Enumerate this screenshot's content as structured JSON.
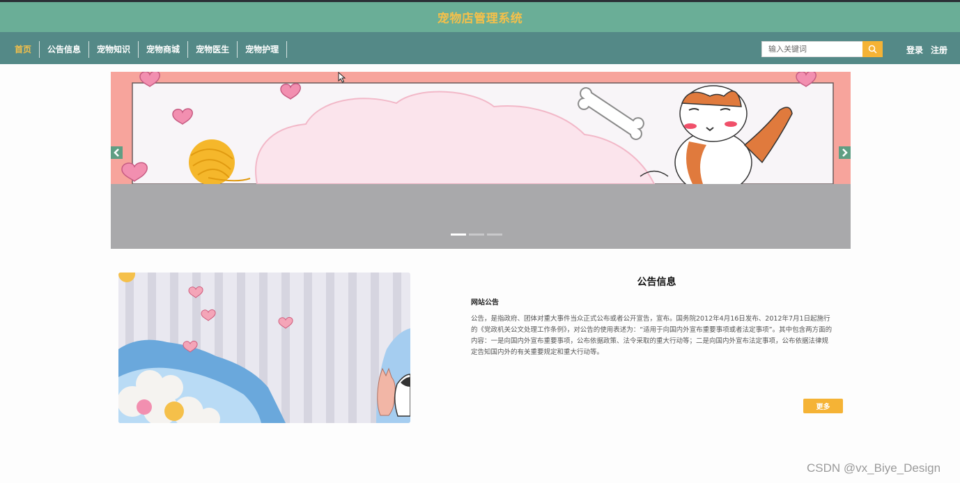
{
  "header": {
    "title": "宠物店管理系统"
  },
  "nav": {
    "items": [
      {
        "label": "首页"
      },
      {
        "label": "公告信息"
      },
      {
        "label": "宠物知识"
      },
      {
        "label": "宠物商城"
      },
      {
        "label": "宠物医生"
      },
      {
        "label": "宠物护理"
      }
    ]
  },
  "search": {
    "placeholder": "输入关键词",
    "value": ""
  },
  "auth": {
    "login": "登录",
    "register": "注册"
  },
  "carousel": {
    "slide_count": 3,
    "active_slide": 1
  },
  "notice": {
    "title": "公告信息",
    "subtitle": "网站公告",
    "body": "公告，是指政府、团体对重大事件当众正式公布或者公开宣告，宣布。国务院2012年4月16日发布、2012年7月1日起施行的《党政机关公文处理工作条例》，对公告的使用表述为：“适用于向国内外宣布重要事项或者法定事项”。其中包含两方面的内容：一是向国内外宣布重要事项，公布依据政策、法令采取的重大行动等；二是向国内外宣布法定事项，公布依据法律规定告知国内外的有关重要规定和重大行动等。",
    "more_label": "更多"
  },
  "watermark": "CSDN @vx_Biye_Design",
  "colors": {
    "title_bar": "#6aae97",
    "nav_bar": "#548987",
    "accent": "#f5b335",
    "active_nav": "#f5c04a"
  }
}
